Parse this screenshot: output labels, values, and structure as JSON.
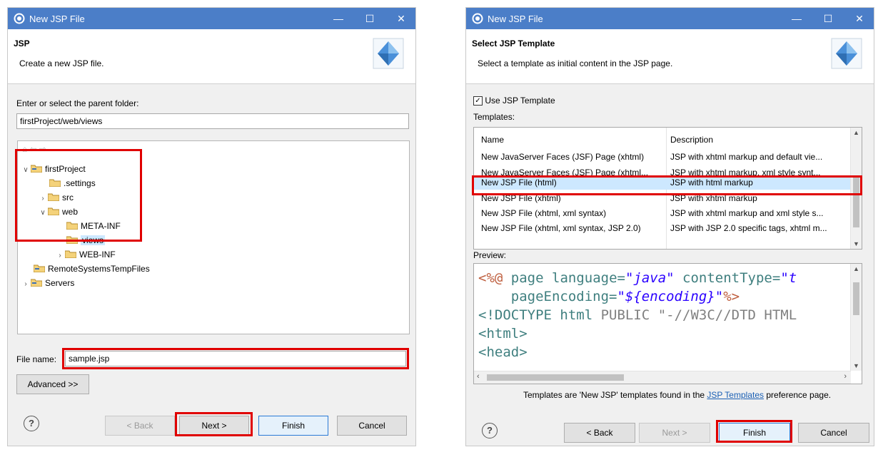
{
  "left_dialog": {
    "window_title": "New JSP File",
    "page_title": "JSP",
    "page_description": "Create a new JSP file.",
    "folder_label": "Enter or select the parent folder:",
    "folder_value": "firstProject/web/views",
    "tree": [
      {
        "label": "firstProject",
        "state": "expanded"
      },
      {
        "label": ".settings",
        "state": "leaf"
      },
      {
        "label": "src",
        "state": "collapsed"
      },
      {
        "label": "web",
        "state": "expanded"
      },
      {
        "label": "META-INF",
        "state": "leaf"
      },
      {
        "label": "views",
        "state": "selected"
      },
      {
        "label": "WEB-INF",
        "state": "collapsed"
      },
      {
        "label": "RemoteSystemsTempFiles",
        "state": "leaf"
      },
      {
        "label": "Servers",
        "state": "collapsed"
      }
    ],
    "filename_label": "File name:",
    "filename_value": "sample.jsp",
    "advanced_label": "Advanced >>",
    "back_label": "< Back",
    "next_label": "Next >",
    "finish_label": "Finish",
    "cancel_label": "Cancel",
    "help_symbol": "?"
  },
  "right_dialog": {
    "window_title": "New JSP File",
    "page_title": "Select JSP Template",
    "page_description": "Select a template as initial content in the JSP page.",
    "use_template_label": "Use JSP Template",
    "use_template_checked": true,
    "templates_label": "Templates:",
    "columns": [
      "Name",
      "Description"
    ],
    "templates": [
      {
        "name": "New JavaServer Faces (JSF) Page (xhtml)",
        "description": "JSP with xhtml markup and default vie..."
      },
      {
        "name": "New JavaServer Faces (JSF) Page (xhtml...",
        "description": "JSP with xhtml markup, xml style synt..."
      },
      {
        "name": "New JSP File (html)",
        "description": "JSP with html markup",
        "selected": true
      },
      {
        "name": "New JSP File (xhtml)",
        "description": "JSP with xhtml markup"
      },
      {
        "name": "New JSP File (xhtml, xml syntax)",
        "description": "JSP with xhtml markup and xml style s..."
      },
      {
        "name": "New JSP File (xhtml, xml syntax, JSP 2.0)",
        "description": "JSP with JSP 2.0 specific tags, xhtml m..."
      }
    ],
    "preview_label": "Preview:",
    "preview_lines": {
      "l1_open": "<%@",
      "l1_kw1": "page",
      "l1_attr1": "language=",
      "l1_val1": "\"java\"",
      "l1_attr2": "contentType=",
      "l1_val2": "\"t",
      "l2_attr": "pageEncoding=",
      "l2_val": "\"${encoding}\"",
      "l2_close": "%>",
      "l3_a": "<!DOCTYPE html",
      "l3_b": "PUBLIC",
      "l3_c": "\"-//W3C//DTD HTML",
      "l4": "<html>",
      "l5": "<head>"
    },
    "footer_text_prefix": "Templates are 'New JSP' templates found in the",
    "footer_link": "JSP Templates",
    "footer_text_suffix": "preference page.",
    "back_label": "< Back",
    "next_label": "Next >",
    "finish_label": "Finish",
    "cancel_label": "Cancel",
    "help_symbol": "?"
  },
  "colors": {
    "titlebar": "#4b7ec8",
    "highlight_box": "#e00000",
    "selection": "#cde8ff"
  }
}
